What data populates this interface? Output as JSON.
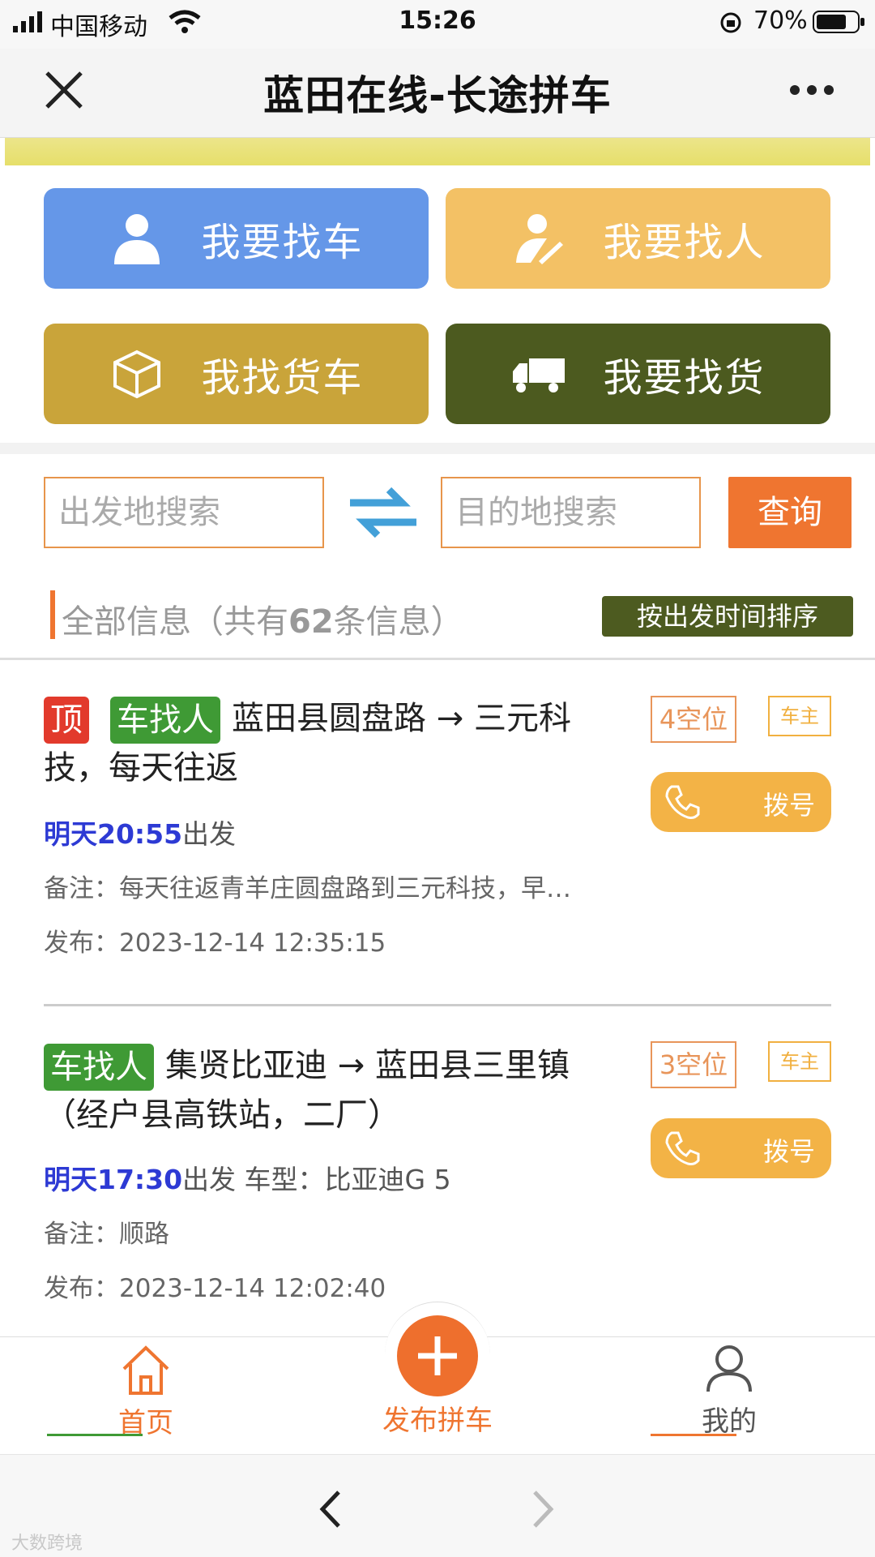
{
  "status_bar": {
    "carrier": "中国移动",
    "time": "15:26",
    "battery": "70%"
  },
  "nav": {
    "title": "蓝田在线-长途拼车"
  },
  "actions": [
    {
      "label": "我要找车",
      "color": "#6597e8",
      "icon": "person-icon"
    },
    {
      "label": "我要找人",
      "color": "#f3c165",
      "icon": "person-edit-icon"
    },
    {
      "label": "我找货车",
      "color": "#c9a43a",
      "icon": "box-icon"
    },
    {
      "label": "我要找货",
      "color": "#4c5a1f",
      "icon": "truck-icon"
    }
  ],
  "search": {
    "origin_placeholder": "出发地搜索",
    "destination_placeholder": "目的地搜索",
    "query_label": "查询"
  },
  "info": {
    "prefix": "全部信息（共有",
    "count": "62",
    "suffix": "条信息）",
    "sort_label": "按出发时间排序"
  },
  "listings": [
    {
      "top_tag": "顶",
      "type_tag": "车找人",
      "route": "蓝田县圆盘路 → 三元科技，每天往返",
      "time": "明天20:55",
      "depart_suffix": "出发",
      "car_model": "",
      "note": "备注：每天往返青羊庄圆盘路到三元科技，早…",
      "published": "发布：2023-12-14 12:35:15",
      "seats": "4空位",
      "role": "车主",
      "dial_label": "拨号"
    },
    {
      "top_tag": "",
      "type_tag": "车找人",
      "route": "集贤比亚迪 → 蓝田县三里镇（经户县高铁站，二厂）",
      "time": "明天17:30",
      "depart_suffix": "出发",
      "car_model": "车型：比亚迪G 5",
      "note": "备注：顺路",
      "published": "发布：2023-12-14 12:02:40",
      "seats": "3空位",
      "role": "车主",
      "dial_label": "拨号"
    }
  ],
  "tabbar": {
    "home": "首页",
    "publish": "发布拼车",
    "mine": "我的"
  },
  "watermark": "大数跨境",
  "colors": {
    "accent": "#ef7530",
    "tag_red": "#e23a2c",
    "tag_green": "#3f9a35",
    "blue_time": "#2d3ad4"
  }
}
